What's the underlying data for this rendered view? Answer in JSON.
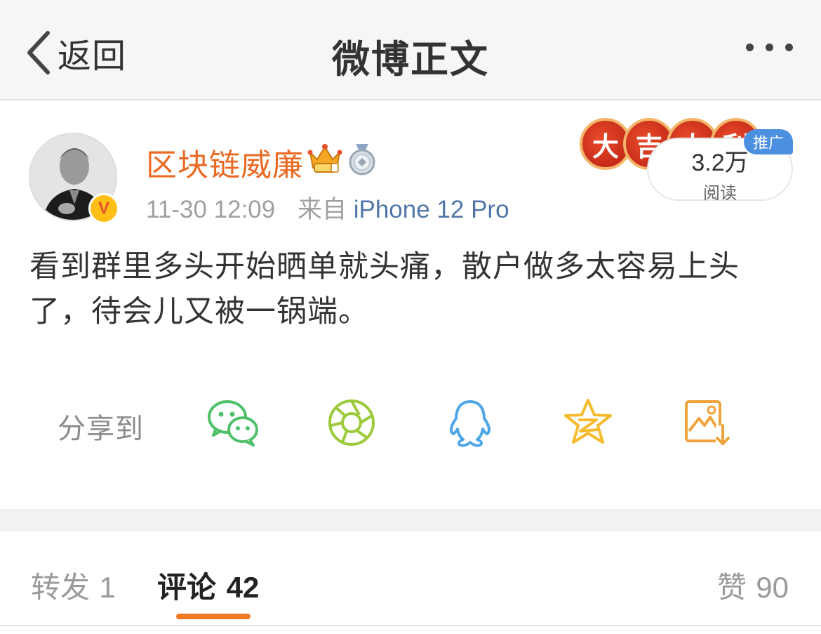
{
  "navbar": {
    "back_label": "返回",
    "title": "微博正文"
  },
  "post": {
    "username": "区块链威廉",
    "badges": [
      "crown-vip-icon",
      "medal-icon"
    ],
    "verified_badge": "V",
    "time": "11-30 12:09",
    "from_label": "来自",
    "device": "iPhone 12 Pro",
    "text": "看到群里多头开始晒单就头痛，散户做多太容易上头了，待会儿又被一锅端。"
  },
  "ad": {
    "coins": [
      "大",
      "吉",
      "大",
      "利"
    ],
    "reads_count": "3.2万",
    "reads_label": "阅读",
    "promo_label": "推广"
  },
  "share": {
    "label": "分享到",
    "targets": [
      "wechat-icon",
      "moments-icon",
      "qq-icon",
      "qzone-icon",
      "save-image-icon"
    ]
  },
  "tabs": {
    "repost_label": "转发",
    "repost_count": "1",
    "comment_label": "评论",
    "comment_count": "42",
    "like_label": "赞",
    "like_count": "90"
  },
  "colors": {
    "username": "#ea6a23",
    "device_link": "#5076a8",
    "tab_underline": "#f07b22"
  }
}
